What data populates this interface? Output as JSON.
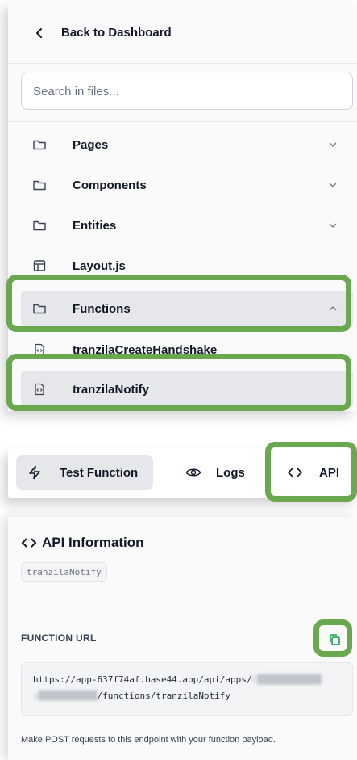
{
  "nav": {
    "back_label": "Back to Dashboard"
  },
  "search": {
    "placeholder": "Search in files..."
  },
  "tree": {
    "items": [
      {
        "label": "Pages",
        "icon": "folder-icon",
        "expandable": true,
        "expanded": false
      },
      {
        "label": "Components",
        "icon": "folder-icon",
        "expandable": true,
        "expanded": false
      },
      {
        "label": "Entities",
        "icon": "folder-icon",
        "expandable": true,
        "expanded": false
      },
      {
        "label": "Layout.js",
        "icon": "layout-file-icon",
        "expandable": false
      },
      {
        "label": "Functions",
        "icon": "folder-icon",
        "expandable": true,
        "expanded": true
      },
      {
        "label": "tranzilaCreateHandshake",
        "icon": "code-file-icon",
        "expandable": false
      },
      {
        "label": "tranzilaNotify",
        "icon": "code-file-icon",
        "expandable": false,
        "selected": true
      }
    ]
  },
  "tabs": {
    "test_label": "Test Function",
    "logs_label": "Logs",
    "api_label": "API"
  },
  "api": {
    "title": "API Information",
    "function_name": "tranzilaNotify",
    "url_label": "FUNCTION URL",
    "url_line1_visible": "https://app-637f74af.base44.app/api/apps/",
    "url_line1_redacted": "6",
    "url_line2_redacted": "a",
    "url_line2_visible": "/functions/tranzilaNotify",
    "note": "Make POST requests to this endpoint with your function payload."
  },
  "colors": {
    "highlight": "#6aa84f",
    "selected_bg": "#e5e7eb",
    "panel_bg": "#fafafa"
  }
}
